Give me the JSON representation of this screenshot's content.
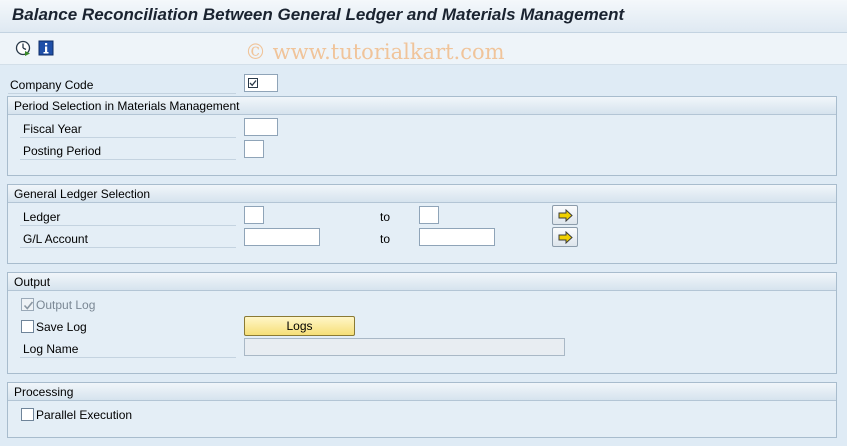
{
  "header": {
    "title": "Balance Reconciliation Between General Ledger and Materials Management"
  },
  "toolbar": {
    "execute_icon": "execute-clock-icon",
    "info_icon": "info-icon"
  },
  "watermark": "© www.tutorialkart.com",
  "company_code": {
    "label": "Company Code",
    "value": ""
  },
  "period_group": {
    "title": "Period Selection in Materials Management",
    "fiscal_year_label": "Fiscal Year",
    "fiscal_year_value": "",
    "posting_period_label": "Posting Period",
    "posting_period_value": ""
  },
  "gl_group": {
    "title": "General Ledger Selection",
    "ledger_label": "Ledger",
    "ledger_from": "",
    "ledger_to_label": "to",
    "ledger_to": "",
    "account_label": "G/L Account",
    "account_from": "",
    "account_to_label": "to",
    "account_to": ""
  },
  "output_group": {
    "title": "Output",
    "output_log_label": "Output Log",
    "output_log_checked": true,
    "save_log_label": "Save Log",
    "save_log_checked": false,
    "logs_button": "Logs",
    "log_name_label": "Log Name",
    "log_name_value": ""
  },
  "processing_group": {
    "title": "Processing",
    "parallel_label": "Parallel Execution",
    "parallel_checked": false
  },
  "colors": {
    "background": "#dfebf5",
    "logs_button": "#f6df78",
    "watermark": "#f0c49a"
  }
}
